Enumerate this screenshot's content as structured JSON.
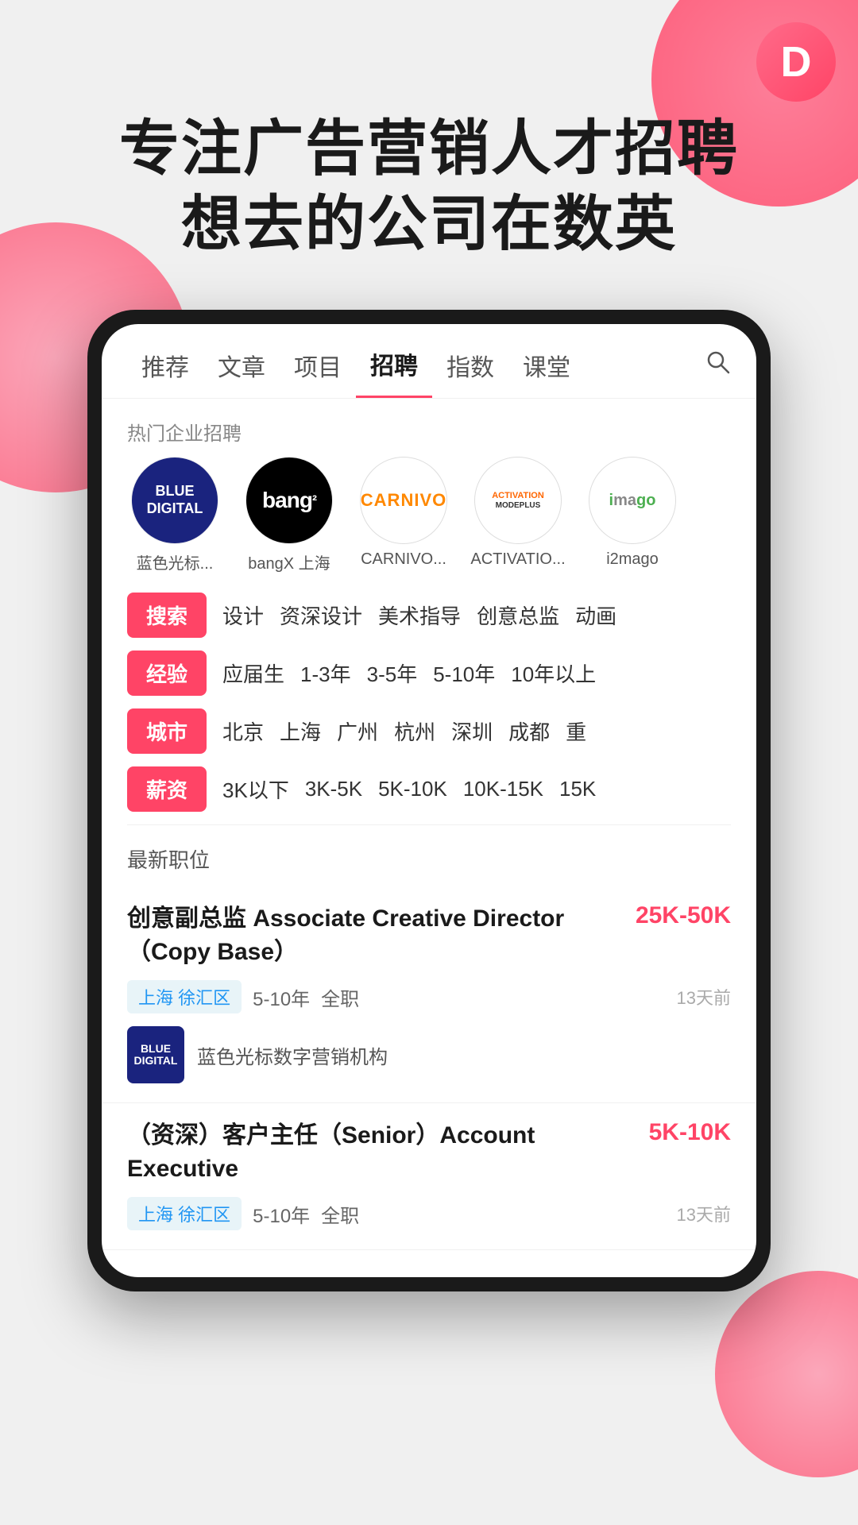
{
  "app": {
    "logo_letter": "D",
    "hero_line1": "专注广告营销人才招聘",
    "hero_line2": "想去的公司在数英"
  },
  "nav": {
    "items": [
      {
        "label": "推荐",
        "active": false
      },
      {
        "label": "文章",
        "active": false
      },
      {
        "label": "项目",
        "active": false
      },
      {
        "label": "招聘",
        "active": true
      },
      {
        "label": "指数",
        "active": false
      },
      {
        "label": "课堂",
        "active": false
      }
    ],
    "search_icon": "search"
  },
  "companies": {
    "section_label": "热门企业招聘",
    "items": [
      {
        "name": "蓝色光标...",
        "logo_text": "BLUE\nDIGITAL",
        "type": "blue-digital"
      },
      {
        "name": "bangX 上海",
        "logo_text": "bang²",
        "type": "bangx"
      },
      {
        "name": "CARNIVO...",
        "logo_text": "CARNIVO",
        "type": "carnivo"
      },
      {
        "name": "ACTIVATIO...",
        "logo_text": "ACTIVATION\nMODEPLUS",
        "type": "activation"
      },
      {
        "name": "i2mago",
        "logo_text": "imago",
        "type": "i2mago"
      }
    ]
  },
  "filters": [
    {
      "tag": "搜索",
      "options": [
        "设计",
        "资深设计",
        "美术指导",
        "创意总监",
        "动画"
      ]
    },
    {
      "tag": "经验",
      "options": [
        "应届生",
        "1-3年",
        "3-5年",
        "5-10年",
        "10年以上"
      ]
    },
    {
      "tag": "城市",
      "options": [
        "北京",
        "上海",
        "广州",
        "杭州",
        "深圳",
        "成都",
        "重"
      ]
    },
    {
      "tag": "薪资",
      "options": [
        "3K以下",
        "3K-5K",
        "5K-10K",
        "10K-15K",
        "15K"
      ]
    }
  ],
  "latest_jobs": {
    "label": "最新职位",
    "items": [
      {
        "title": "创意副总监 Associate Creative Director（Copy Base）",
        "salary": "25K-50K",
        "location": "上海 徐汇区",
        "experience": "5-10年",
        "type": "全职",
        "posted": "13天前",
        "company_name": "蓝色光标数字营销机构",
        "company_logo_text": "BLUE\nDIGITAL",
        "company_logo_type": "blue-digital"
      },
      {
        "title": "（资深）客户主任（Senior）Account Executive",
        "salary": "5K-10K",
        "location": "上海 徐汇区",
        "experience": "5-10年",
        "type": "全职",
        "posted": "13天前",
        "company_name": "",
        "company_logo_text": "",
        "company_logo_type": ""
      }
    ]
  }
}
